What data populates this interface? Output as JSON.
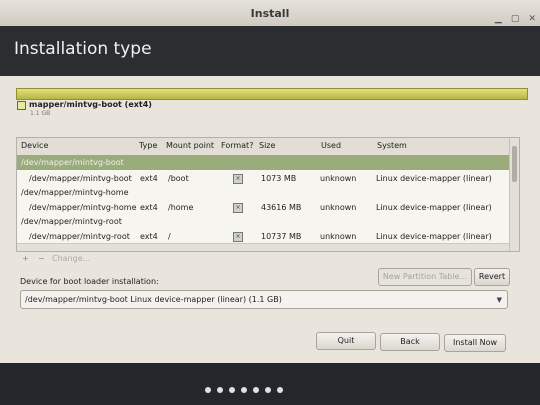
{
  "window": {
    "title": "Install",
    "min_icon": "minimize-icon",
    "max_icon": "maximize-icon",
    "close_icon": "close-icon"
  },
  "header": {
    "title": "Installation type"
  },
  "partition": {
    "name": "mapper/mintvg-boot (ext4)",
    "size": "1.1 GB"
  },
  "table": {
    "columns": [
      "Device",
      "Type",
      "Mount point",
      "Format?",
      "Size",
      "Used",
      "System"
    ],
    "rows": [
      {
        "device": "/dev/mapper/mintvg-boot",
        "type": "",
        "mount": "",
        "format": false,
        "size": "",
        "used": "",
        "system": "",
        "selected": true
      },
      {
        "device": "/dev/mapper/mintvg-boot",
        "type": "ext4",
        "mount": "/boot",
        "format": true,
        "size": "1073 MB",
        "used": "unknown",
        "system": "Linux device-mapper (linear)"
      },
      {
        "device": "/dev/mapper/mintvg-home",
        "type": "",
        "mount": "",
        "format": false,
        "size": "",
        "used": "",
        "system": ""
      },
      {
        "device": "/dev/mapper/mintvg-home",
        "type": "ext4",
        "mount": "/home",
        "format": true,
        "size": "43616 MB",
        "used": "unknown",
        "system": "Linux device-mapper (linear)"
      },
      {
        "device": "/dev/mapper/mintvg-root",
        "type": "",
        "mount": "",
        "format": false,
        "size": "",
        "used": "",
        "system": ""
      },
      {
        "device": "/dev/mapper/mintvg-root",
        "type": "ext4",
        "mount": "/",
        "format": true,
        "size": "10737 MB",
        "used": "unknown",
        "system": "Linux device-mapper (linear)"
      }
    ]
  },
  "toolbar": {
    "add": "+",
    "remove": "−",
    "change": "Change..."
  },
  "buttons": {
    "new_partition_table": "New Partition Table...",
    "revert": "Revert",
    "quit": "Quit",
    "back": "Back",
    "install_now": "Install Now"
  },
  "bootloader": {
    "label": "Device for boot loader installation:",
    "value": "/dev/mapper/mintvg-boot   Linux device-mapper (linear) (1.1 GB)"
  },
  "progress": {
    "total_steps": 7,
    "current_step": 1
  }
}
